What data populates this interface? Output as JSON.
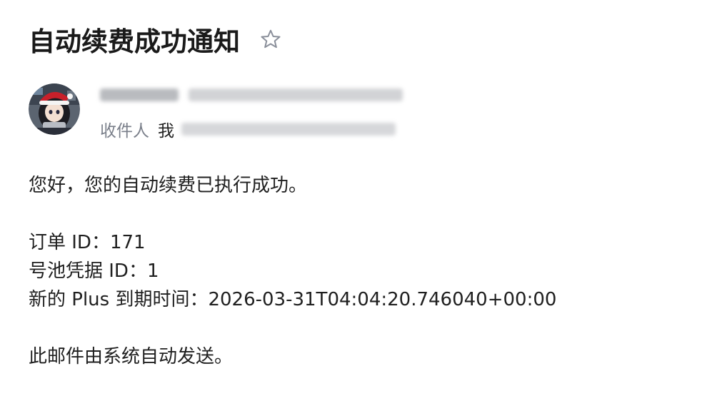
{
  "email": {
    "subject": "自动续费成功通知",
    "recipient_label": "收件人",
    "recipient_name": "我",
    "body": {
      "greeting": "您好，您的自动续费已执行成功。",
      "order_id": "订单 ID：171",
      "credential_id": "号池凭据 ID：1",
      "expiry": "新的 Plus 到期时间：2026-03-31T04:04:20.746040+00:00",
      "footer": "此邮件由系统自动发送。"
    }
  },
  "icons": {
    "star": "star-outline-icon",
    "avatar": "avatar"
  },
  "colors": {
    "subject": "#1a1a1a",
    "label_gray": "#7a7f8a",
    "text": "#1f1f1f",
    "star_outline": "#8a8f9a"
  }
}
